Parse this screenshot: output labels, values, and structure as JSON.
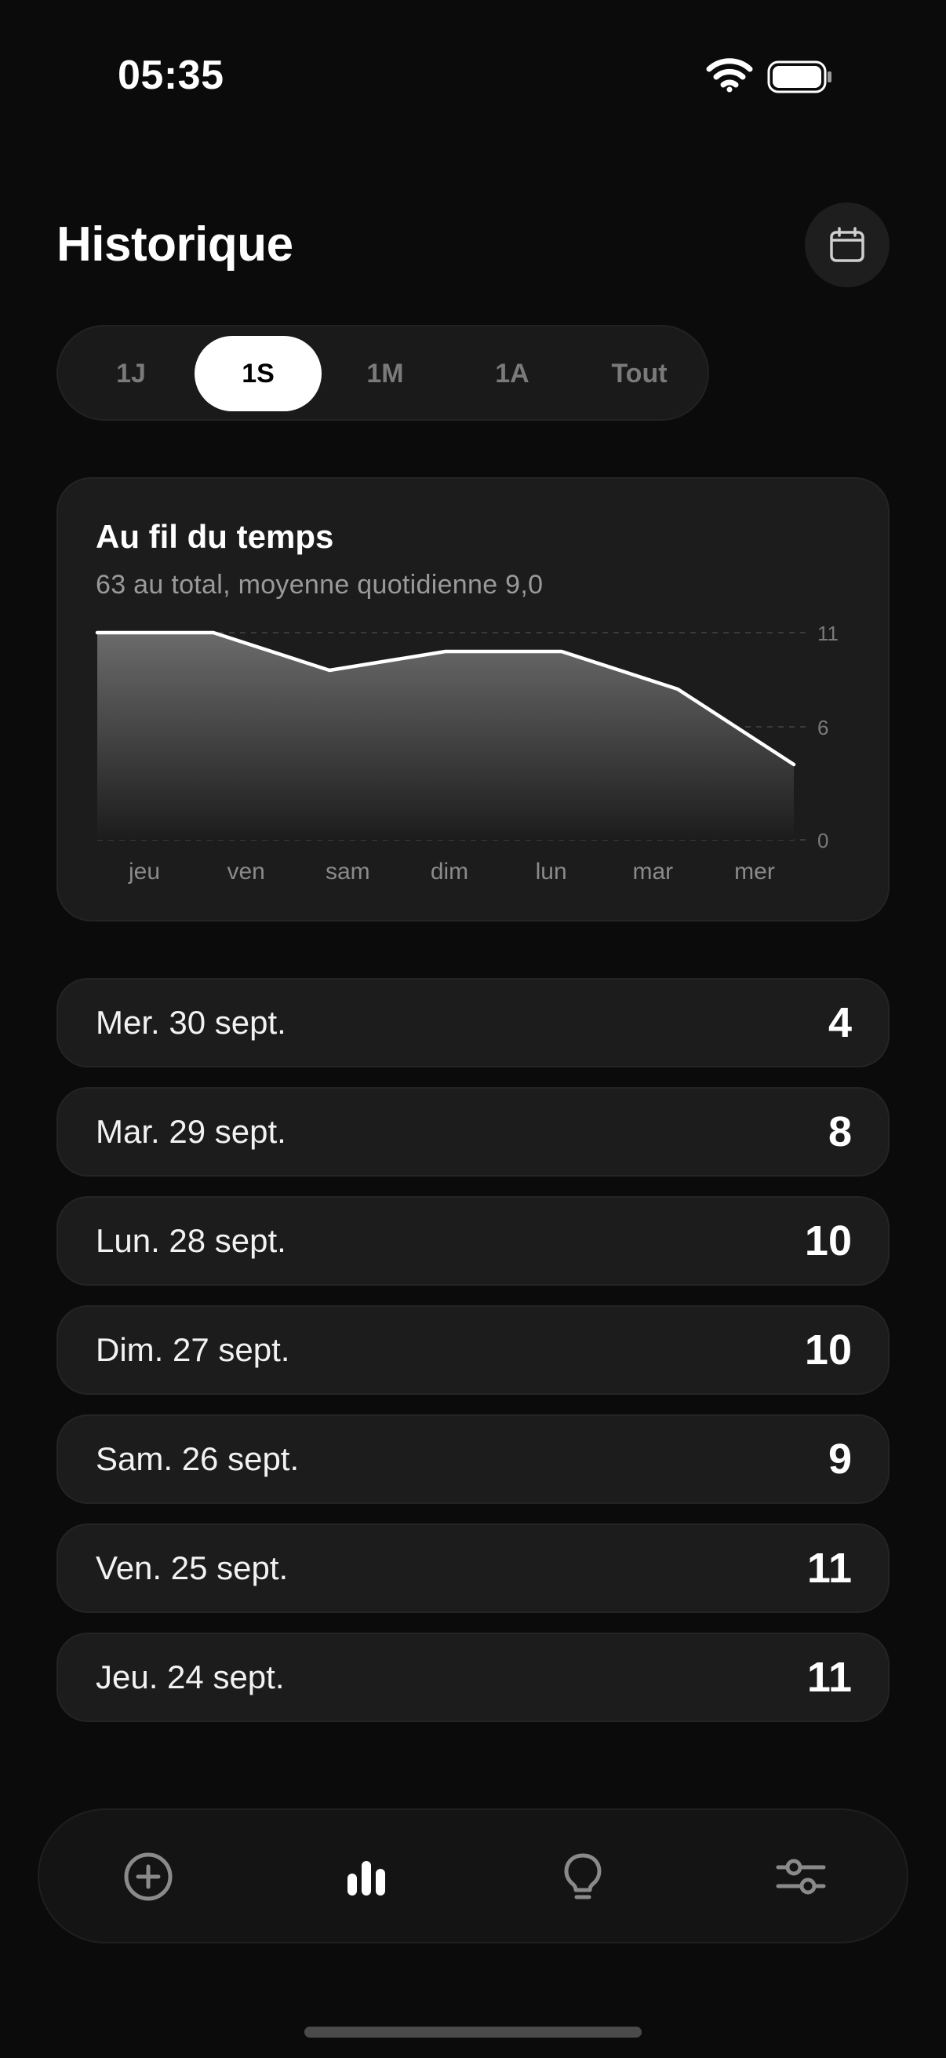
{
  "status_bar": {
    "time": "05:35"
  },
  "header": {
    "title": "Historique",
    "calendar_icon": "calendar-icon"
  },
  "range_selector": {
    "options": [
      "1J",
      "1S",
      "1M",
      "1A",
      "Tout"
    ],
    "selected": "1S"
  },
  "chart_card": {
    "title": "Au fil du temps",
    "subtitle": "63 au total, moyenne quotidienne 9,0"
  },
  "chart_data": {
    "type": "area",
    "title": "Au fil du temps",
    "subtitle": "63 au total, moyenne quotidienne 9,0",
    "categories": [
      "jeu",
      "ven",
      "sam",
      "dim",
      "lun",
      "mar",
      "mer"
    ],
    "values": [
      11,
      11,
      9,
      10,
      10,
      8,
      4
    ],
    "y_ticks": [
      "11",
      "6",
      "0"
    ],
    "ylim": [
      0,
      11
    ],
    "grid": "dashed-horizontal",
    "colors": {
      "line": "#ffffff",
      "fill_top": "#6b6b6b",
      "fill_bottom": "#1c1c1c"
    }
  },
  "days": [
    {
      "label": "Mer. 30 sept.",
      "value": "4"
    },
    {
      "label": "Mar. 29 sept.",
      "value": "8"
    },
    {
      "label": "Lun. 28 sept.",
      "value": "10"
    },
    {
      "label": "Dim. 27 sept.",
      "value": "10"
    },
    {
      "label": "Sam. 26 sept.",
      "value": "9"
    },
    {
      "label": "Ven. 25 sept.",
      "value": "11"
    },
    {
      "label": "Jeu. 24 sept.",
      "value": "11"
    }
  ],
  "tab_bar": {
    "items": [
      {
        "icon": "plus-circle-icon",
        "active": false
      },
      {
        "icon": "bar-chart-icon",
        "active": true
      },
      {
        "icon": "lightbulb-icon",
        "active": false
      },
      {
        "icon": "sliders-icon",
        "active": false
      }
    ]
  }
}
